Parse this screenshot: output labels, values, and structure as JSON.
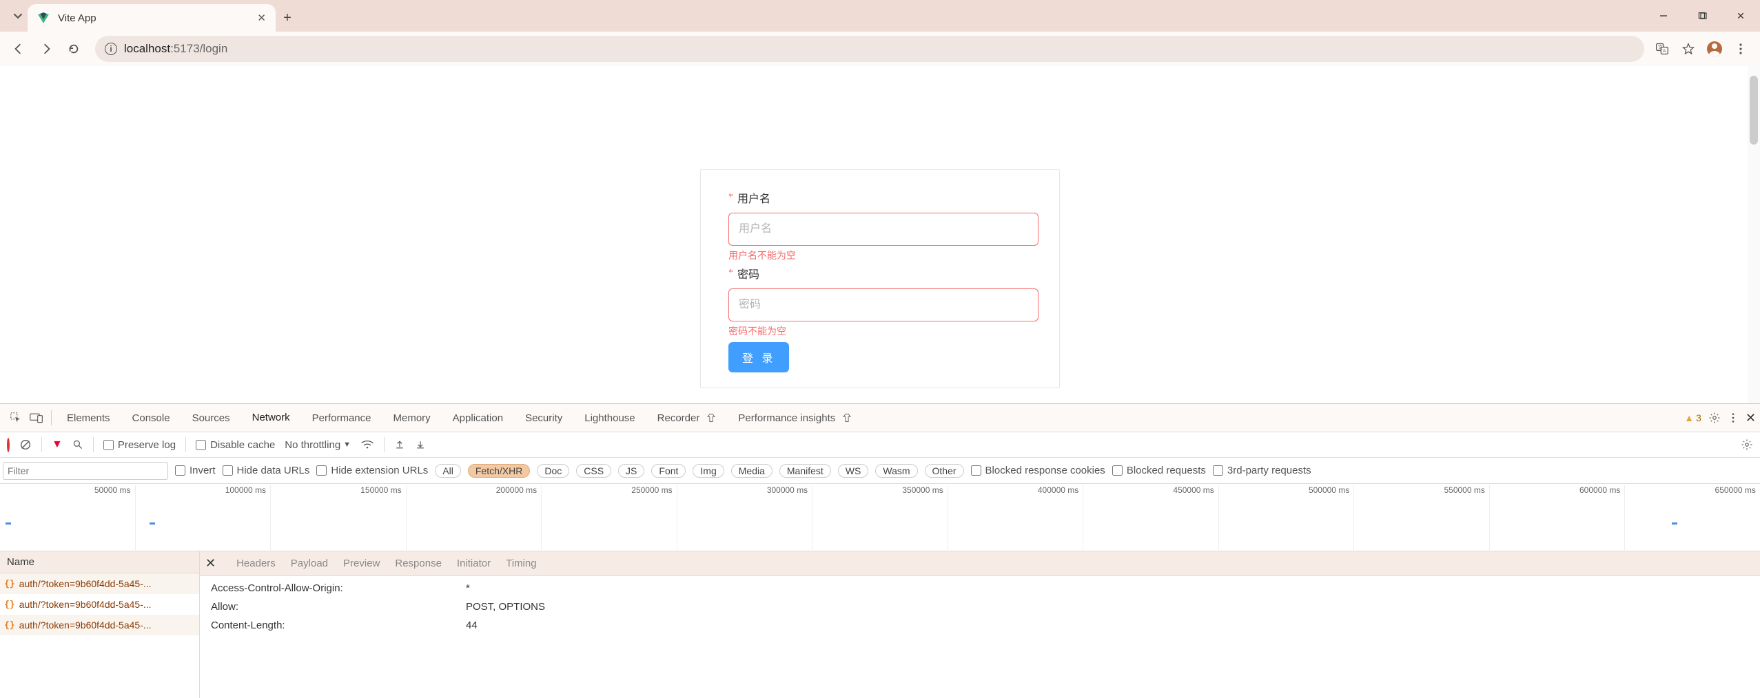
{
  "browser": {
    "tab_title": "Vite App",
    "url_host": "localhost",
    "url_port_path": ":5173/login"
  },
  "login_form": {
    "username_label": "用户名",
    "username_placeholder": "用户名",
    "username_error": "用户名不能为空",
    "password_label": "密码",
    "password_placeholder": "密码",
    "password_error": "密码不能为空",
    "submit_label": "登 录"
  },
  "devtools": {
    "tabs": [
      "Elements",
      "Console",
      "Sources",
      "Network",
      "Performance",
      "Memory",
      "Application",
      "Security",
      "Lighthouse",
      "Recorder",
      "Performance insights"
    ],
    "active_tab": "Network",
    "warning_count": "3",
    "net_toolbar": {
      "preserve_log": "Preserve log",
      "disable_cache": "Disable cache",
      "throttling": "No throttling"
    },
    "filter": {
      "placeholder": "Filter",
      "invert": "Invert",
      "hide_data_urls": "Hide data URLs",
      "hide_ext_urls": "Hide extension URLs",
      "types": [
        "All",
        "Fetch/XHR",
        "Doc",
        "CSS",
        "JS",
        "Font",
        "Img",
        "Media",
        "Manifest",
        "WS",
        "Wasm",
        "Other"
      ],
      "active_type": "Fetch/XHR",
      "blocked_cookies": "Blocked response cookies",
      "blocked_requests": "Blocked requests",
      "third_party": "3rd-party requests"
    },
    "timeline_ticks": [
      "50000 ms",
      "100000 ms",
      "150000 ms",
      "200000 ms",
      "250000 ms",
      "300000 ms",
      "350000 ms",
      "400000 ms",
      "450000 ms",
      "500000 ms",
      "550000 ms",
      "600000 ms",
      "650000 ms"
    ],
    "request_list": {
      "header": "Name",
      "rows": [
        "auth/?token=9b60f4dd-5a45-...",
        "auth/?token=9b60f4dd-5a45-...",
        "auth/?token=9b60f4dd-5a45-..."
      ]
    },
    "detail_tabs": [
      "Headers",
      "Payload",
      "Preview",
      "Response",
      "Initiator",
      "Timing"
    ],
    "detail_active": "Headers",
    "response_headers": [
      {
        "k": "Access-Control-Allow-Origin:",
        "v": "*"
      },
      {
        "k": "Allow:",
        "v": "POST, OPTIONS"
      },
      {
        "k": "Content-Length:",
        "v": "44"
      }
    ]
  }
}
